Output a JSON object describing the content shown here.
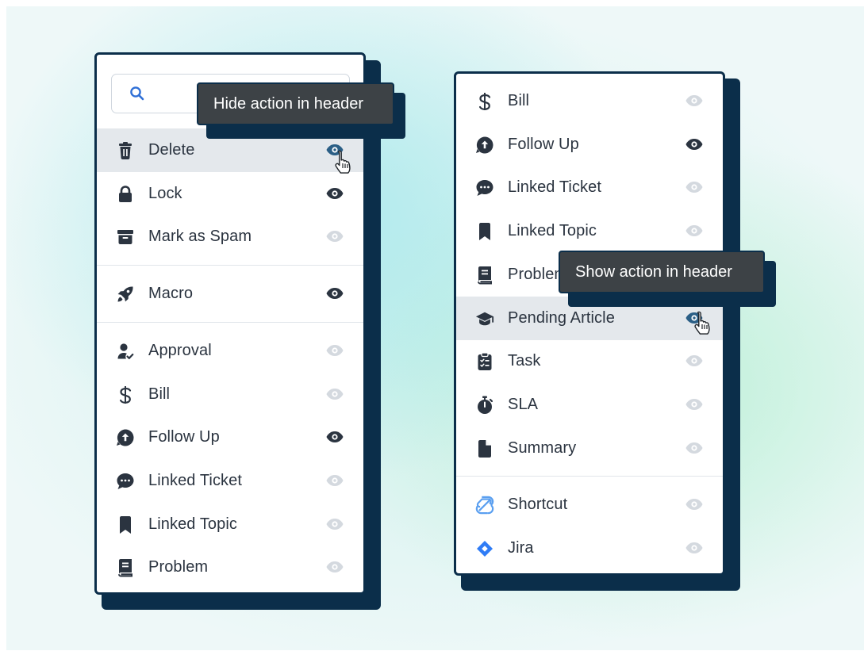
{
  "left_panel": {
    "search": {
      "placeholder": ""
    },
    "tooltip": "Hide action in header",
    "groups": [
      [
        {
          "label": "Delete",
          "icon": "trash-icon",
          "visible": true,
          "highlighted": true
        },
        {
          "label": "Lock",
          "icon": "lock-icon",
          "visible": true
        },
        {
          "label": "Mark as Spam",
          "icon": "archive-icon",
          "visible": false
        }
      ],
      [
        {
          "label": "Macro",
          "icon": "rocket-icon",
          "visible": true
        }
      ],
      [
        {
          "label": "Approval",
          "icon": "user-check-icon",
          "visible": false
        },
        {
          "label": "Bill",
          "icon": "dollar-icon",
          "visible": false
        },
        {
          "label": "Follow Up",
          "icon": "follow-up-icon",
          "visible": true
        },
        {
          "label": "Linked Ticket",
          "icon": "chat-bubble-icon",
          "visible": false
        },
        {
          "label": "Linked Topic",
          "icon": "bookmark-icon",
          "visible": false
        },
        {
          "label": "Problem",
          "icon": "book-icon",
          "visible": false
        }
      ]
    ]
  },
  "right_panel": {
    "tooltip": "Show action in header",
    "groups": [
      [
        {
          "label": "Bill",
          "icon": "dollar-icon",
          "visible": false
        },
        {
          "label": "Follow Up",
          "icon": "follow-up-icon",
          "visible": true
        },
        {
          "label": "Linked Ticket",
          "icon": "chat-bubble-icon",
          "visible": false
        },
        {
          "label": "Linked Topic",
          "icon": "bookmark-icon",
          "visible": false
        },
        {
          "label": "Problem",
          "icon": "book-icon",
          "visible": false
        },
        {
          "label": "Pending Article",
          "icon": "graduation-cap-icon",
          "visible": true,
          "highlighted": true
        },
        {
          "label": "Task",
          "icon": "clipboard-icon",
          "visible": false
        },
        {
          "label": "SLA",
          "icon": "stopwatch-icon",
          "visible": false
        },
        {
          "label": "Summary",
          "icon": "document-icon",
          "visible": false
        }
      ],
      [
        {
          "label": "Shortcut",
          "icon": "shortcut-logo-icon",
          "visible": false
        },
        {
          "label": "Jira",
          "icon": "jira-logo-icon",
          "visible": false
        }
      ]
    ]
  },
  "colors": {
    "navy": "#0b2e4a",
    "eye_active": "#2b3440",
    "eye_inactive": "#c9cfd6",
    "eye_hover": "#2b5f86",
    "shortcut_blue": "#5a9ff0",
    "jira_blue": "#2f7cf6"
  }
}
